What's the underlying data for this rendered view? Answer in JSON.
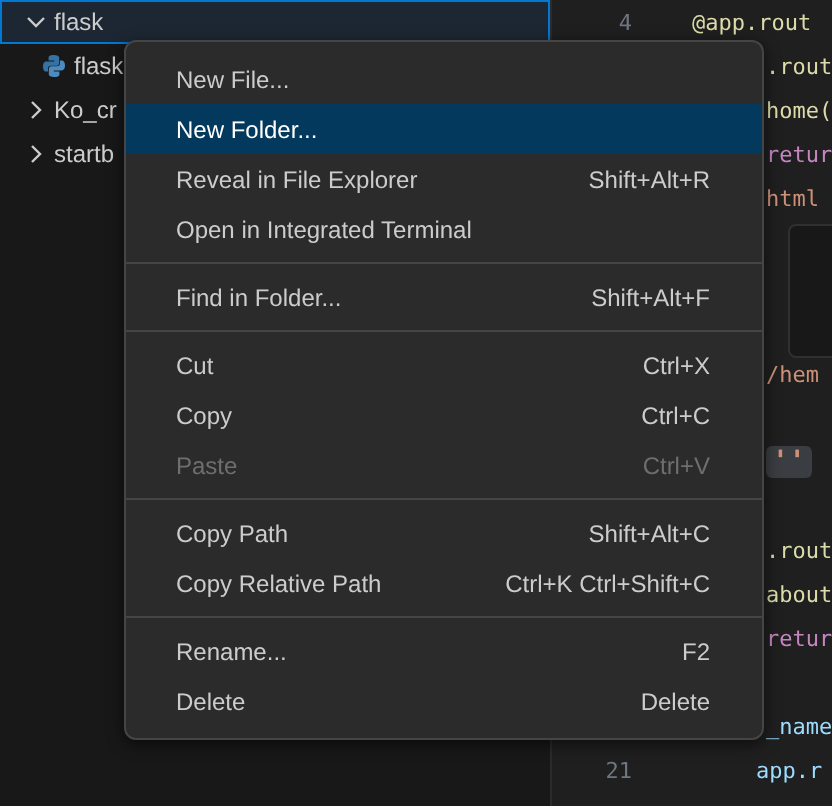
{
  "sidebar": {
    "items": [
      {
        "label": "flask",
        "kind": "folder",
        "expanded": true,
        "selected": true,
        "children": [
          {
            "label": "flask",
            "kind": "python",
            "selected": false
          }
        ]
      },
      {
        "label": "Ko_cr",
        "kind": "folder",
        "expanded": false,
        "selected": false
      },
      {
        "label": "startb",
        "kind": "folder",
        "expanded": false,
        "selected": false
      }
    ]
  },
  "editor": {
    "lines": [
      {
        "number": "4",
        "text": "@app.rout",
        "kind": "full",
        "color": "#dcdcaa"
      },
      {
        "text": ".rout",
        "kind": "covered",
        "color": "#dcdcaa"
      },
      {
        "text": "home(",
        "kind": "covered",
        "color": "#dcdcaa"
      },
      {
        "text": "retur",
        "kind": "covered",
        "color": "#c586c0"
      },
      {
        "text": "html",
        "kind": "covered",
        "color": "#ce9178"
      },
      {
        "kind": "blank"
      },
      {
        "kind": "blank"
      },
      {
        "kind": "blank"
      },
      {
        "text": "/hem",
        "kind": "covered",
        "color": "#ce9178"
      },
      {
        "kind": "blank"
      },
      {
        "text": "''",
        "kind": "highlighted"
      },
      {
        "kind": "blank"
      },
      {
        "text": ".rout",
        "kind": "covered",
        "color": "#dcdcaa"
      },
      {
        "text": "about",
        "kind": "covered",
        "color": "#dcdcaa"
      },
      {
        "text": "retur",
        "kind": "covered",
        "color": "#c586c0"
      },
      {
        "kind": "blank"
      },
      {
        "text": "_name",
        "kind": "covered",
        "color": "#9cdcfe"
      },
      {
        "number": "21",
        "text": "app.r",
        "kind": "indented",
        "color": "#9cdcfe"
      }
    ],
    "hover_panel": true
  },
  "context_menu": {
    "groups": [
      [
        {
          "label": "New File...",
          "selected": false,
          "disabled": false
        },
        {
          "label": "New Folder...",
          "selected": true,
          "disabled": false
        },
        {
          "label": "Reveal in File Explorer",
          "shortcut": "Shift+Alt+R",
          "selected": false,
          "disabled": false
        },
        {
          "label": "Open in Integrated Terminal",
          "selected": false,
          "disabled": false
        }
      ],
      [
        {
          "label": "Find in Folder...",
          "shortcut": "Shift+Alt+F",
          "selected": false,
          "disabled": false
        }
      ],
      [
        {
          "label": "Cut",
          "shortcut": "Ctrl+X",
          "selected": false,
          "disabled": false
        },
        {
          "label": "Copy",
          "shortcut": "Ctrl+C",
          "selected": false,
          "disabled": false
        },
        {
          "label": "Paste",
          "shortcut": "Ctrl+V",
          "selected": false,
          "disabled": true
        }
      ],
      [
        {
          "label": "Copy Path",
          "shortcut": "Shift+Alt+C",
          "selected": false,
          "disabled": false
        },
        {
          "label": "Copy Relative Path",
          "shortcut": "Ctrl+K Ctrl+Shift+C",
          "selected": false,
          "disabled": false
        }
      ],
      [
        {
          "label": "Rename...",
          "shortcut": "F2",
          "selected": false,
          "disabled": false
        },
        {
          "label": "Delete",
          "shortcut": "Delete",
          "selected": false,
          "disabled": false
        }
      ]
    ]
  }
}
